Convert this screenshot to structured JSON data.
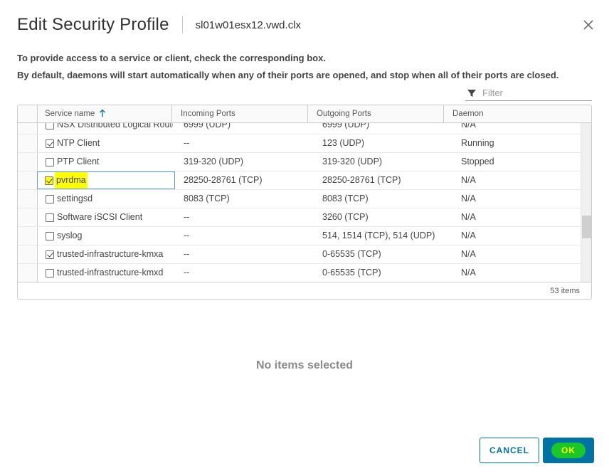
{
  "dialog": {
    "title": "Edit Security Profile",
    "host": "sl01w01esx12.vwd.clx",
    "intro_line1": "To provide access to a service or client, check the corresponding box.",
    "intro_line2": "By default, daemons will start automatically when any of their ports are opened, and stop when all of their ports are closed."
  },
  "filter": {
    "placeholder": "Filter"
  },
  "grid": {
    "columns": [
      "Service name",
      "Incoming Ports",
      "Outgoing Ports",
      "Daemon"
    ],
    "rows": [
      {
        "name": "NSX Distributed Logical Router",
        "incoming": "6999 (UDP)",
        "outgoing": "6999 (UDP)",
        "daemon": "N/A",
        "checked": false
      },
      {
        "name": "NTP Client",
        "incoming": "--",
        "outgoing": "123 (UDP)",
        "daemon": "Running",
        "checked": true
      },
      {
        "name": "PTP Client",
        "incoming": "319-320 (UDP)",
        "outgoing": "319-320 (UDP)",
        "daemon": "Stopped",
        "checked": false
      },
      {
        "name": "pvrdma",
        "incoming": "28250-28761 (TCP)",
        "outgoing": "28250-28761 (TCP)",
        "daemon": "N/A",
        "checked": true
      },
      {
        "name": "settingsd",
        "incoming": "8083 (TCP)",
        "outgoing": "8083 (TCP)",
        "daemon": "N/A",
        "checked": false
      },
      {
        "name": "Software iSCSI Client",
        "incoming": "--",
        "outgoing": "3260 (TCP)",
        "daemon": "N/A",
        "checked": false
      },
      {
        "name": "syslog",
        "incoming": "--",
        "outgoing": "514, 1514 (TCP), 514 (UDP)",
        "daemon": "N/A",
        "checked": false
      },
      {
        "name": "trusted-infrastructure-kmxa",
        "incoming": "--",
        "outgoing": "0-65535 (TCP)",
        "daemon": "N/A",
        "checked": true
      },
      {
        "name": "trusted-infrastructure-kmxd",
        "incoming": "--",
        "outgoing": "0-65535 (TCP)",
        "daemon": "N/A",
        "checked": false
      }
    ],
    "footer": "53 items"
  },
  "detail": {
    "empty_message": "No items selected"
  },
  "buttons": {
    "cancel": "CANCEL",
    "ok": "OK"
  },
  "colors": {
    "primary": "#0072a3",
    "highlight": "#ffff00",
    "ok_highlight": "#19c72b"
  },
  "icons": {
    "close": "close-icon",
    "filter": "filter-icon",
    "sort": "sort-ascending-icon"
  }
}
